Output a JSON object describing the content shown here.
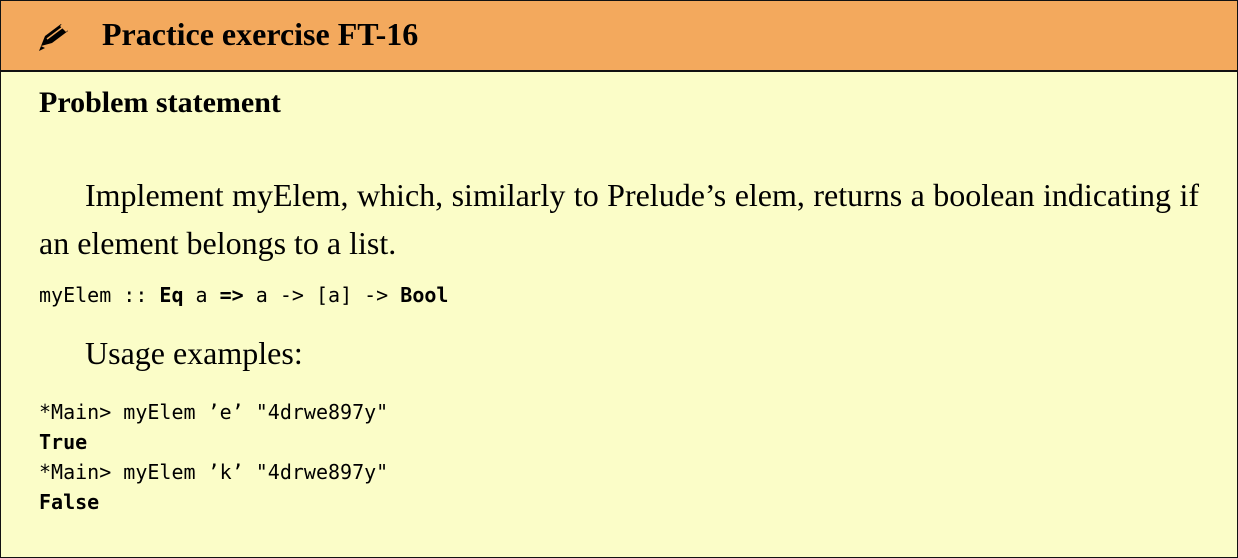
{
  "header": {
    "icon": "pencil-icon",
    "title": "Practice exercise FT-16"
  },
  "body": {
    "heading": "Problem statement",
    "paragraph": "Implement myElem, which, similarly to Prelude’s elem, returns a boolean indicating if an element belongs to a list.",
    "signature": {
      "name": "myElem",
      "sep": " :: ",
      "eq": "Eq",
      "a1": " a ",
      "arrow_fat": "=>",
      "rest": " a -> [a] -> ",
      "bool": "Bool"
    },
    "usage_label": "Usage examples:",
    "examples": [
      {
        "prompt": "*Main> myElem ’e’ \"4drwe897y\"",
        "result": "True"
      },
      {
        "prompt": "*Main> myElem ’k’ \"4drwe897y\"",
        "result": "False"
      }
    ]
  },
  "colors": {
    "header_bg": "#f3a95d",
    "body_bg": "#fbfdc8"
  }
}
